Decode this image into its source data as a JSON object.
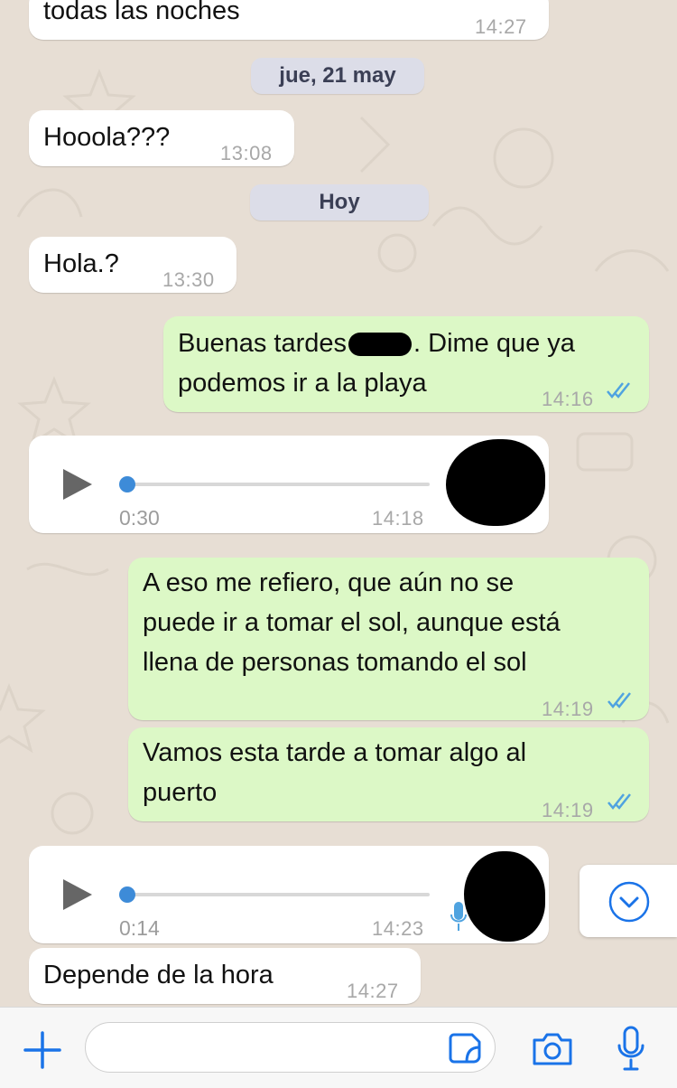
{
  "messages": [
    {
      "id": "m1",
      "dir": "in",
      "text": "todas las noches",
      "time": "14:27"
    },
    {
      "id": "d1",
      "type": "date",
      "text": "jue, 21 may"
    },
    {
      "id": "m2",
      "dir": "in",
      "text": "Hooola???",
      "time": "13:08"
    },
    {
      "id": "d2",
      "type": "date",
      "text": "Hoy"
    },
    {
      "id": "m3",
      "dir": "in",
      "text": "Hola.?",
      "time": "13:30"
    },
    {
      "id": "m4",
      "dir": "out",
      "line1_a": "Buenas tardes",
      "line1_b": ". Dime que ya",
      "line2": "podemos ir a la playa",
      "time": "14:16"
    },
    {
      "id": "v1",
      "dir": "in",
      "type": "voice",
      "duration": "0:30",
      "time": "14:18",
      "progress": 0
    },
    {
      "id": "m5",
      "dir": "out",
      "line1": "A eso me refiero, que aún no se",
      "line2": "puede ir a tomar el sol, aunque está",
      "line3": "llena de personas tomando el sol",
      "time": "14:19"
    },
    {
      "id": "m6",
      "dir": "out",
      "line1": "Vamos esta tarde a tomar algo al",
      "line2": "puerto",
      "time": "14:19"
    },
    {
      "id": "v2",
      "dir": "in",
      "type": "voice",
      "duration": "0:14",
      "time": "14:23",
      "progress": 0
    },
    {
      "id": "m7",
      "dir": "in",
      "text": "Depende de la hora",
      "time": "14:27"
    }
  ],
  "colors": {
    "incoming": "#ffffff",
    "outgoing": "#dcf8c6",
    "read_ticks": "#4fa3e0",
    "accent": "#1a73e8"
  },
  "icons": {
    "add": "plus-icon",
    "sticker": "sticker-icon",
    "camera": "camera-icon",
    "mic": "microphone-icon",
    "scroll": "chevron-down-circle-icon"
  },
  "composer": {
    "placeholder": ""
  }
}
